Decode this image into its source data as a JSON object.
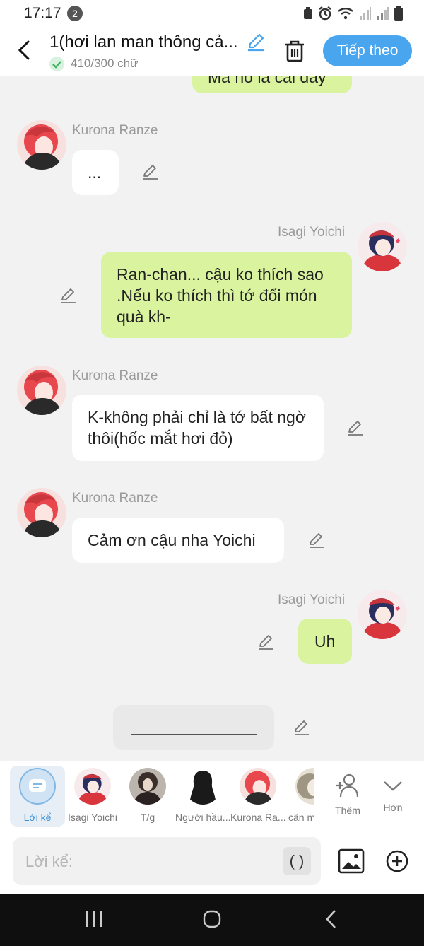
{
  "status_bar": {
    "time": "17:17",
    "notification_count": "2"
  },
  "header": {
    "title": "1(hơi lan man thông cả...",
    "word_count": "410/300 chữ",
    "next_label": "Tiếp theo"
  },
  "messages": [
    {
      "text": "Mà nó là cái đấy"
    },
    {
      "speaker": "Kurona Ranze",
      "text": "..."
    },
    {
      "speaker": "Isagi Yoichi",
      "text": "Ran-chan... cậu ko thích sao .Nếu ko thích thì tớ đổi món quà kh-"
    },
    {
      "speaker": "Kurona Ranze",
      "text": "K-không phải chỉ là tớ bất ngờ thôi(hốc mắt hơi đỏ)"
    },
    {
      "speaker": "Kurona Ranze",
      "text": "Cảm ơn cậu nha Yoichi"
    },
    {
      "speaker": "Isagi Yoichi",
      "text": "Uh"
    }
  ],
  "characters": [
    {
      "label": "Lời kể"
    },
    {
      "label": "Isagi Yoichi"
    },
    {
      "label": "T/g"
    },
    {
      "label": "Người hầu..."
    },
    {
      "label": "Kurona Ra..."
    },
    {
      "label": "cân m"
    },
    {
      "label": "Thêm"
    },
    {
      "label": "Hơn"
    }
  ],
  "input": {
    "placeholder": "Lời kể:",
    "paren_label": "( )"
  },
  "colors": {
    "accent": "#4aa5ef",
    "green_bubble": "#d9f39e",
    "red_hair": "#e8484d",
    "navy_hair": "#2b2f5e"
  }
}
